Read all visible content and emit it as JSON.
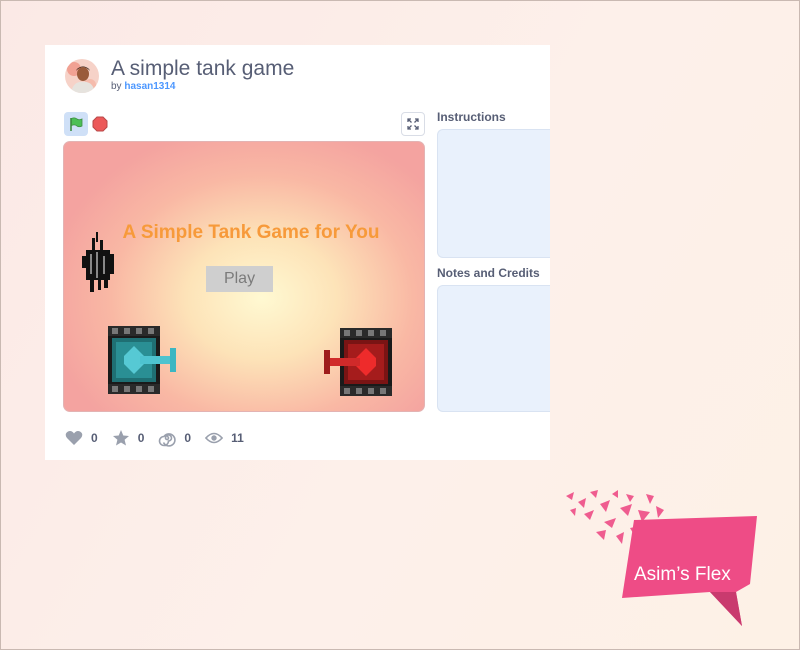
{
  "project": {
    "title": "A simple tank game",
    "by_label": "by",
    "author": "hasan1314"
  },
  "stage": {
    "game_title": "A Simple Tank Game for You",
    "play_label": "Play"
  },
  "sidebar": {
    "instructions_label": "Instructions",
    "notes_label": "Notes and Credits"
  },
  "stats": {
    "loves": "0",
    "favorites": "0",
    "remixes": "0",
    "views": "11"
  },
  "watermark": {
    "text": "Asim’s Flex"
  },
  "colors": {
    "text": "#575e75",
    "link": "#4c97ff",
    "game_title": "#f79a3a",
    "flag": "#4cbf56",
    "stop": "#ec5959",
    "logo_pink": "#ee4c86"
  }
}
